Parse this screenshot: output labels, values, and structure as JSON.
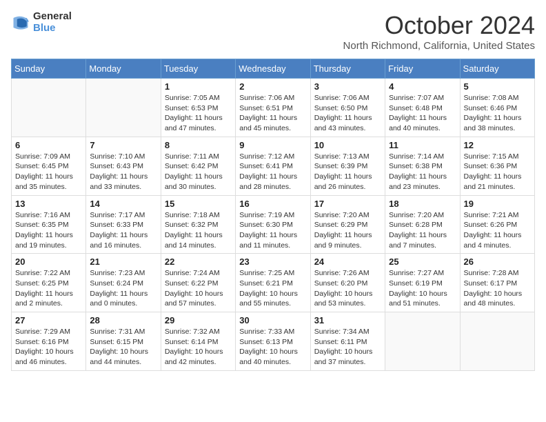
{
  "logo": {
    "general": "General",
    "blue": "Blue"
  },
  "title": "October 2024",
  "location": "North Richmond, California, United States",
  "weekdays": [
    "Sunday",
    "Monday",
    "Tuesday",
    "Wednesday",
    "Thursday",
    "Friday",
    "Saturday"
  ],
  "weeks": [
    [
      {
        "day": "",
        "info": ""
      },
      {
        "day": "",
        "info": ""
      },
      {
        "day": "1",
        "info": "Sunrise: 7:05 AM\nSunset: 6:53 PM\nDaylight: 11 hours and 47 minutes."
      },
      {
        "day": "2",
        "info": "Sunrise: 7:06 AM\nSunset: 6:51 PM\nDaylight: 11 hours and 45 minutes."
      },
      {
        "day": "3",
        "info": "Sunrise: 7:06 AM\nSunset: 6:50 PM\nDaylight: 11 hours and 43 minutes."
      },
      {
        "day": "4",
        "info": "Sunrise: 7:07 AM\nSunset: 6:48 PM\nDaylight: 11 hours and 40 minutes."
      },
      {
        "day": "5",
        "info": "Sunrise: 7:08 AM\nSunset: 6:46 PM\nDaylight: 11 hours and 38 minutes."
      }
    ],
    [
      {
        "day": "6",
        "info": "Sunrise: 7:09 AM\nSunset: 6:45 PM\nDaylight: 11 hours and 35 minutes."
      },
      {
        "day": "7",
        "info": "Sunrise: 7:10 AM\nSunset: 6:43 PM\nDaylight: 11 hours and 33 minutes."
      },
      {
        "day": "8",
        "info": "Sunrise: 7:11 AM\nSunset: 6:42 PM\nDaylight: 11 hours and 30 minutes."
      },
      {
        "day": "9",
        "info": "Sunrise: 7:12 AM\nSunset: 6:41 PM\nDaylight: 11 hours and 28 minutes."
      },
      {
        "day": "10",
        "info": "Sunrise: 7:13 AM\nSunset: 6:39 PM\nDaylight: 11 hours and 26 minutes."
      },
      {
        "day": "11",
        "info": "Sunrise: 7:14 AM\nSunset: 6:38 PM\nDaylight: 11 hours and 23 minutes."
      },
      {
        "day": "12",
        "info": "Sunrise: 7:15 AM\nSunset: 6:36 PM\nDaylight: 11 hours and 21 minutes."
      }
    ],
    [
      {
        "day": "13",
        "info": "Sunrise: 7:16 AM\nSunset: 6:35 PM\nDaylight: 11 hours and 19 minutes."
      },
      {
        "day": "14",
        "info": "Sunrise: 7:17 AM\nSunset: 6:33 PM\nDaylight: 11 hours and 16 minutes."
      },
      {
        "day": "15",
        "info": "Sunrise: 7:18 AM\nSunset: 6:32 PM\nDaylight: 11 hours and 14 minutes."
      },
      {
        "day": "16",
        "info": "Sunrise: 7:19 AM\nSunset: 6:30 PM\nDaylight: 11 hours and 11 minutes."
      },
      {
        "day": "17",
        "info": "Sunrise: 7:20 AM\nSunset: 6:29 PM\nDaylight: 11 hours and 9 minutes."
      },
      {
        "day": "18",
        "info": "Sunrise: 7:20 AM\nSunset: 6:28 PM\nDaylight: 11 hours and 7 minutes."
      },
      {
        "day": "19",
        "info": "Sunrise: 7:21 AM\nSunset: 6:26 PM\nDaylight: 11 hours and 4 minutes."
      }
    ],
    [
      {
        "day": "20",
        "info": "Sunrise: 7:22 AM\nSunset: 6:25 PM\nDaylight: 11 hours and 2 minutes."
      },
      {
        "day": "21",
        "info": "Sunrise: 7:23 AM\nSunset: 6:24 PM\nDaylight: 11 hours and 0 minutes."
      },
      {
        "day": "22",
        "info": "Sunrise: 7:24 AM\nSunset: 6:22 PM\nDaylight: 10 hours and 57 minutes."
      },
      {
        "day": "23",
        "info": "Sunrise: 7:25 AM\nSunset: 6:21 PM\nDaylight: 10 hours and 55 minutes."
      },
      {
        "day": "24",
        "info": "Sunrise: 7:26 AM\nSunset: 6:20 PM\nDaylight: 10 hours and 53 minutes."
      },
      {
        "day": "25",
        "info": "Sunrise: 7:27 AM\nSunset: 6:19 PM\nDaylight: 10 hours and 51 minutes."
      },
      {
        "day": "26",
        "info": "Sunrise: 7:28 AM\nSunset: 6:17 PM\nDaylight: 10 hours and 48 minutes."
      }
    ],
    [
      {
        "day": "27",
        "info": "Sunrise: 7:29 AM\nSunset: 6:16 PM\nDaylight: 10 hours and 46 minutes."
      },
      {
        "day": "28",
        "info": "Sunrise: 7:31 AM\nSunset: 6:15 PM\nDaylight: 10 hours and 44 minutes."
      },
      {
        "day": "29",
        "info": "Sunrise: 7:32 AM\nSunset: 6:14 PM\nDaylight: 10 hours and 42 minutes."
      },
      {
        "day": "30",
        "info": "Sunrise: 7:33 AM\nSunset: 6:13 PM\nDaylight: 10 hours and 40 minutes."
      },
      {
        "day": "31",
        "info": "Sunrise: 7:34 AM\nSunset: 6:11 PM\nDaylight: 10 hours and 37 minutes."
      },
      {
        "day": "",
        "info": ""
      },
      {
        "day": "",
        "info": ""
      }
    ]
  ]
}
